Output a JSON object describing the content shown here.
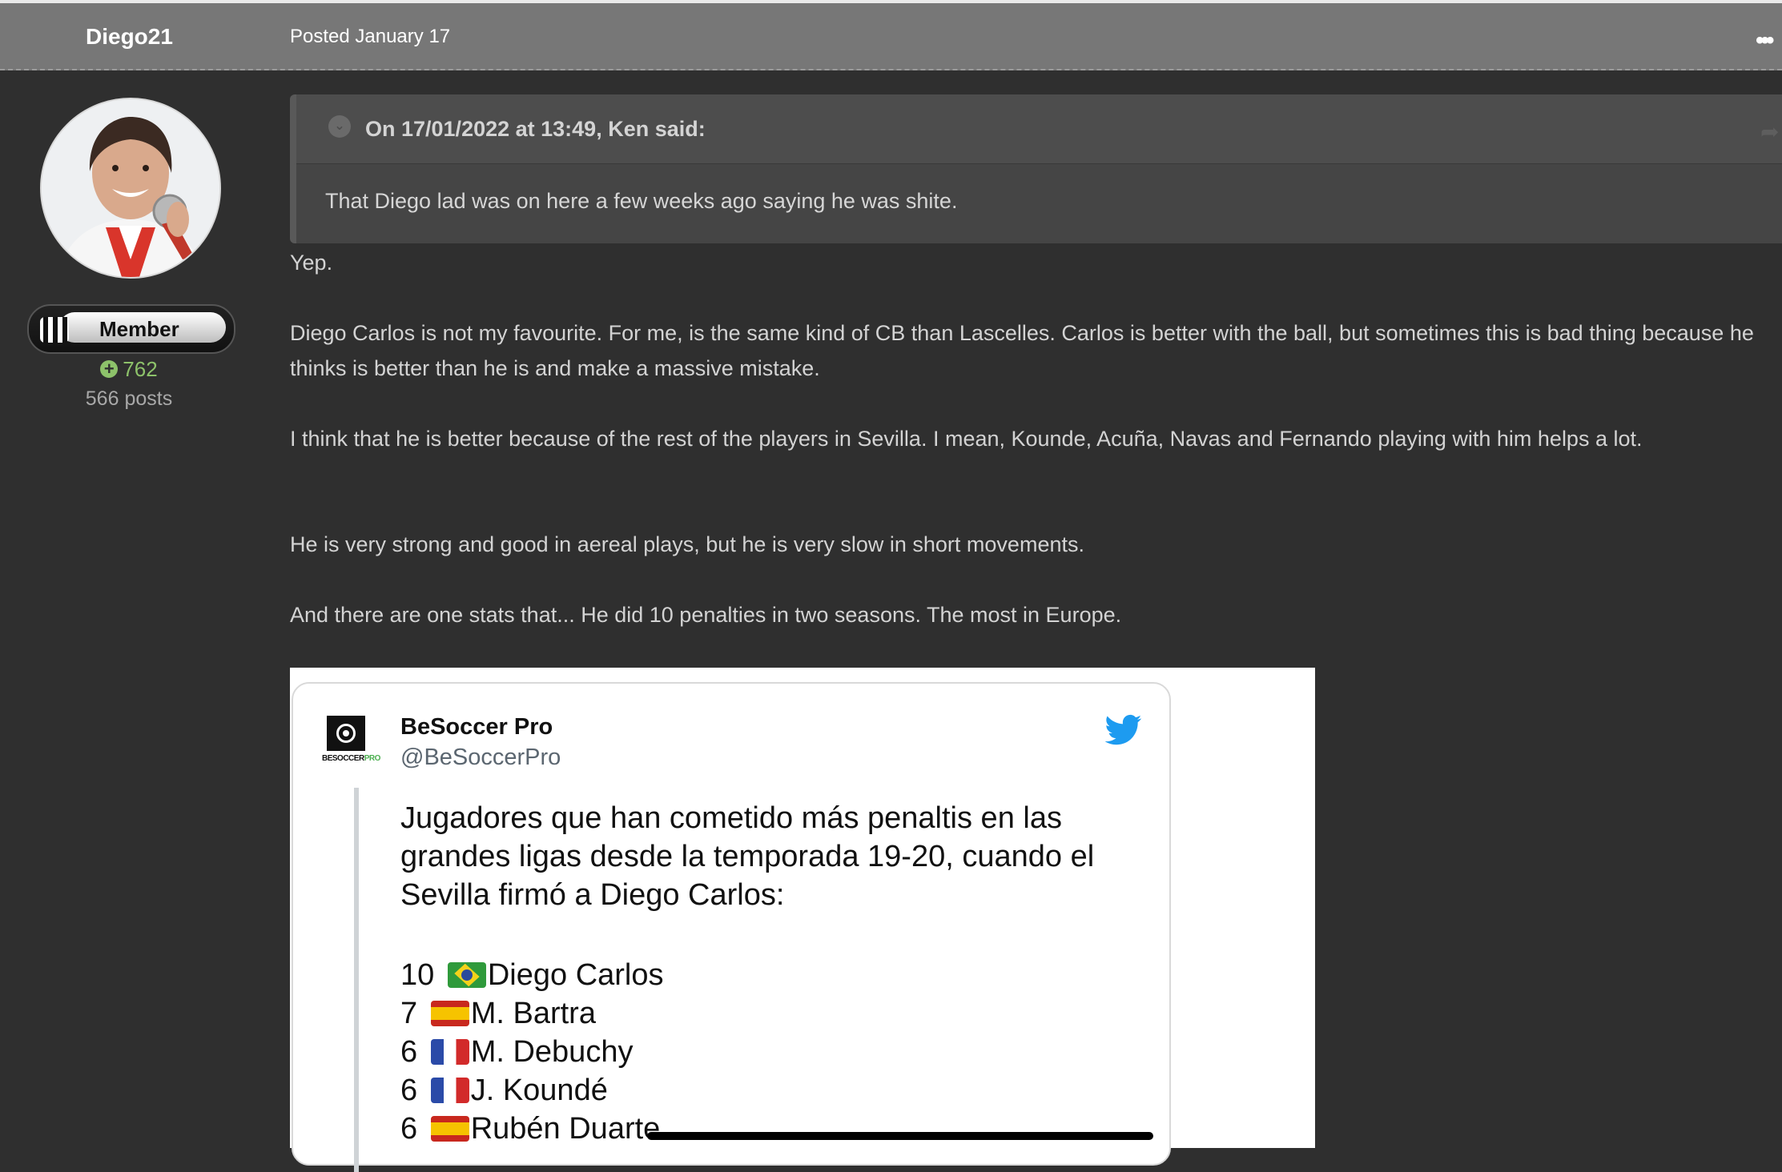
{
  "header": {
    "author": "Diego21",
    "posted": "Posted January 17",
    "more_icon": "ellipsis-icon"
  },
  "author_panel": {
    "rank": "Member",
    "reputation": "762",
    "posts": "566 posts"
  },
  "quote": {
    "citation": "On 17/01/2022 at 13:49, Ken said:",
    "text": "That Diego lad was on here a few weeks ago saying he was shite."
  },
  "body": {
    "p1": "Yep.",
    "p2": "Diego Carlos is not my favourite. For me, is the same kind of CB than Lascelles. Carlos is better with the ball, but sometimes this is bad thing because he thinks is better than he is and make a massive mistake.",
    "p3": "I think that he is better because of the rest of the players in Sevilla. I mean, Kounde, Acuña, Navas and Fernando playing with him helps a lot.",
    "p4": "He is very strong and good in aereal plays, but he is very slow in short movements.",
    "p5": "And there are one stats that... He did 10 penalties in two seasons. The most in Europe."
  },
  "tweet": {
    "name": "BeSoccer Pro",
    "handle": "@BeSoccerPro",
    "logo_text": "BESOCCER",
    "logo_pro": "PRO",
    "text": "Jugadores que han cometido más penaltis en las grandes ligas desde la temporada 19-20, cuando el Sevilla firmó a Diego Carlos:",
    "list": [
      {
        "count": "10",
        "flag": "br",
        "name": "Diego Carlos"
      },
      {
        "count": "7",
        "flag": "es",
        "name": "M. Bartra"
      },
      {
        "count": "6",
        "flag": "fr",
        "name": "M. Debuchy"
      },
      {
        "count": "6",
        "flag": "fr",
        "name": "J. Koundé"
      },
      {
        "count": "6",
        "flag": "es",
        "name": "Rubén Duarte"
      }
    ]
  },
  "colors": {
    "background": "#2f2f2f",
    "header": "#777777",
    "reputation": "#8dc26a",
    "twitter_blue": "#1d9bf0"
  }
}
